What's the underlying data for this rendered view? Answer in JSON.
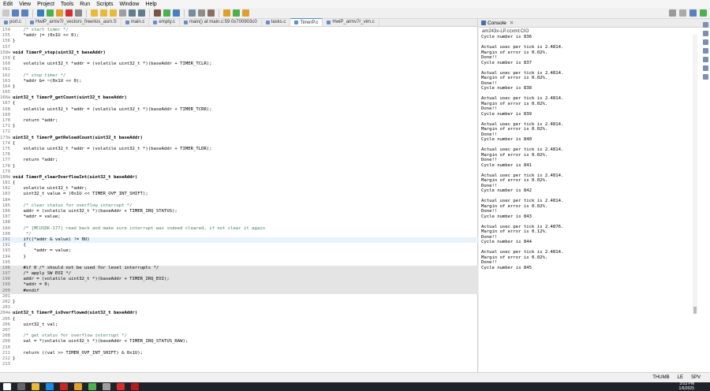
{
  "menu": [
    "Edit",
    "View",
    "Project",
    "Tools",
    "Run",
    "Scripts",
    "Window",
    "Help"
  ],
  "tabs": [
    {
      "label": "port.c",
      "active": false
    },
    {
      "label": "HwiP_armv7r_vectors_freertos_asm.S",
      "active": false
    },
    {
      "label": "main.c",
      "active": false
    },
    {
      "label": "empty.c",
      "active": false
    },
    {
      "label": "main() at main.c:59 0x700903c0",
      "active": false
    },
    {
      "label": "tasks.c",
      "active": false
    },
    {
      "label": "TimerP.c",
      "active": true
    },
    {
      "label": "HwiP_armv7r_vim.c",
      "active": false
    }
  ],
  "code_lines": [
    {
      "n": "154",
      "t": "    /* start timer */",
      "k": "cm"
    },
    {
      "n": "155",
      "t": "    *addr |= (0x1U << 0);",
      "k": ""
    },
    {
      "n": "156",
      "t": "}",
      "k": ""
    },
    {
      "n": "157",
      "t": "",
      "k": ""
    },
    {
      "n": "158⊖",
      "t": "void TimerP_stop(uint32_t baseAddr)",
      "k": "fn"
    },
    {
      "n": "159",
      "t": "{",
      "k": ""
    },
    {
      "n": "160",
      "t": "    volatile uint32_t *addr = (volatile uint32_t *)(baseAddr + TIMER_TCLR);",
      "k": ""
    },
    {
      "n": "161",
      "t": "",
      "k": ""
    },
    {
      "n": "162",
      "t": "    /* stop timer */",
      "k": "cm"
    },
    {
      "n": "163",
      "t": "    *addr &= ~(0x1U << 0);",
      "k": ""
    },
    {
      "n": "164",
      "t": "}",
      "k": ""
    },
    {
      "n": "165",
      "t": "",
      "k": ""
    },
    {
      "n": "166⊖",
      "t": "uint32_t TimerP_getCount(uint32_t baseAddr)",
      "k": "fn"
    },
    {
      "n": "167",
      "t": "{",
      "k": ""
    },
    {
      "n": "168",
      "t": "    volatile uint32_t *addr = (volatile uint32_t *)(baseAddr + TIMER_TCRR);",
      "k": ""
    },
    {
      "n": "169",
      "t": "",
      "k": ""
    },
    {
      "n": "170",
      "t": "    return *addr;",
      "k": ""
    },
    {
      "n": "171",
      "t": "}",
      "k": ""
    },
    {
      "n": "172",
      "t": "",
      "k": ""
    },
    {
      "n": "173⊖",
      "t": "uint32_t TimerP_getReloadCount(uint32_t baseAddr)",
      "k": "fn"
    },
    {
      "n": "174",
      "t": "{",
      "k": ""
    },
    {
      "n": "175",
      "t": "    volatile uint32_t *addr = (volatile uint32_t *)(baseAddr + TIMER_TLDR);",
      "k": ""
    },
    {
      "n": "176",
      "t": "",
      "k": ""
    },
    {
      "n": "177",
      "t": "    return *addr;",
      "k": ""
    },
    {
      "n": "178",
      "t": "}",
      "k": ""
    },
    {
      "n": "179",
      "t": "",
      "k": ""
    },
    {
      "n": "180⊖",
      "t": "void TimerP_clearOverflowInt(uint32_t baseAddr)",
      "k": "fn"
    },
    {
      "n": "181",
      "t": "{",
      "k": ""
    },
    {
      "n": "182",
      "t": "    volatile uint32_t *addr;",
      "k": ""
    },
    {
      "n": "183",
      "t": "    uint32_t value = (0x1U << TIMER_OVF_INT_SHIFT);",
      "k": ""
    },
    {
      "n": "184",
      "t": "",
      "k": ""
    },
    {
      "n": "185",
      "t": "    /* clear status for overflow interrupt */",
      "k": "cm"
    },
    {
      "n": "186",
      "t": "    addr = (volatile uint32_t *)(baseAddr + TIMER_IRQ_STATUS);",
      "k": ""
    },
    {
      "n": "187",
      "t": "    *addr = value;",
      "k": ""
    },
    {
      "n": "188",
      "t": "",
      "k": ""
    },
    {
      "n": "189",
      "t": "    /* [MCUSDK-177] read back and make sure interrupt was indeed cleared, if not clear it again",
      "k": "cm"
    },
    {
      "n": "190",
      "t": "     */",
      "k": "cm"
    },
    {
      "n": "191",
      "t": "    if((*addr & value) != 0U)",
      "k": "cur"
    },
    {
      "n": "192",
      "t": "    {",
      "k": ""
    },
    {
      "n": "193",
      "t": "        *addr = value;",
      "k": ""
    },
    {
      "n": "194",
      "t": "    }",
      "k": ""
    },
    {
      "n": "195",
      "t": "",
      "k": ""
    },
    {
      "n": "196",
      "t": "    #if 0 /* should not be used for level interrupts */",
      "k": "hl"
    },
    {
      "n": "197",
      "t": "    /* apply SW EOI */",
      "k": "hl"
    },
    {
      "n": "198",
      "t": "    addr = (volatile uint32_t *)(baseAddr + TIMER_IRQ_EOI);",
      "k": "hl"
    },
    {
      "n": "199",
      "t": "    *addr = 0;",
      "k": "hl"
    },
    {
      "n": "200",
      "t": "    #endif",
      "k": "hl"
    },
    {
      "n": "201",
      "t": "",
      "k": ""
    },
    {
      "n": "202",
      "t": "}",
      "k": ""
    },
    {
      "n": "203",
      "t": "",
      "k": ""
    },
    {
      "n": "204⊖",
      "t": "uint32_t TimerP_isOverflowed(uint32_t baseAddr)",
      "k": "fn"
    },
    {
      "n": "205",
      "t": "{",
      "k": ""
    },
    {
      "n": "206",
      "t": "    uint32_t val;",
      "k": ""
    },
    {
      "n": "207",
      "t": "",
      "k": ""
    },
    {
      "n": "208",
      "t": "    /* get status for overflow interrupt */",
      "k": "cm"
    },
    {
      "n": "209",
      "t": "    val = *(volatile uint32_t *)(baseAddr + TIMER_IRQ_STATUS_RAW);",
      "k": ""
    },
    {
      "n": "210",
      "t": "",
      "k": ""
    },
    {
      "n": "211",
      "t": "    return ((val >> TIMER_OVF_INT_SHIFT) & 0x1U);",
      "k": ""
    },
    {
      "n": "212",
      "t": "}",
      "k": ""
    },
    {
      "n": "213",
      "t": "",
      "k": ""
    }
  ],
  "console": {
    "tab_label": "Console",
    "title": "am243x-LP.ccxml:CIO",
    "text": "Cycle number is 836\n\nActual usec per tick is 2.4814.\nMargin of error is 0.02%.\nDone!!\nCycle number is 837\n\nActual usec per tick is 2.4814.\nMargin of error is 0.02%.\nDone!!\nCycle number is 838\n\nActual usec per tick is 2.4814.\nMargin of error is 0.02%.\nDone!!\nCycle number is 839\n\nActual usec per tick is 2.4814.\nMargin of error is 0.02%.\nDone!!\nCycle number is 840\n\nActual usec per tick is 2.4814.\nMargin of error is 0.02%.\nDone!!\nCycle number is 841\n\nActual usec per tick is 2.4814.\nMargin of error is 0.02%.\nDone!!\nCycle number is 842\n\nActual usec per tick is 2.4814.\nMargin of error is 0.02%.\nDone!!\nCycle number is 843\n\nActual usec per tick is 2.4876.\nMargin of error is 0.12%.\nDone!!\nCycle number is 844\n\nActual usec per tick is 2.4814.\nMargin of error is 0.02%.\nDone!!\nCycle number is 845"
  },
  "status": {
    "mode": "THUMB",
    "endian": "LE",
    "spv": "SPV"
  },
  "clock": {
    "time": "3:03 PM",
    "date": "1/6/2025"
  }
}
